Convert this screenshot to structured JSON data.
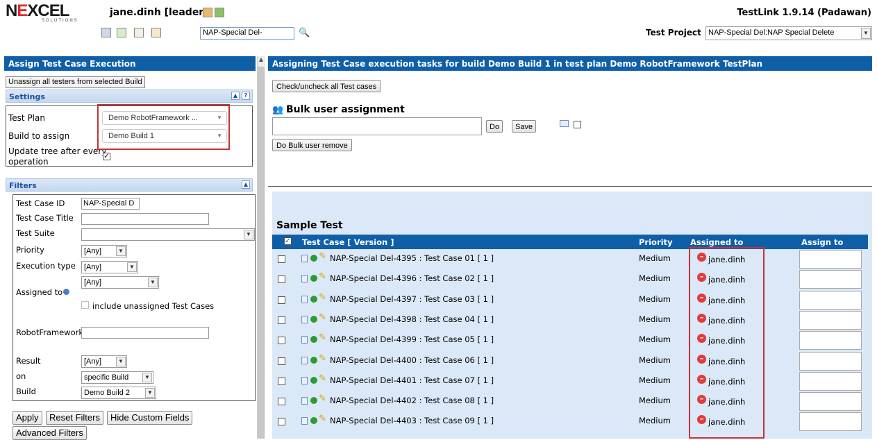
{
  "header": {
    "logo_brand_a": "N",
    "logo_brand_e": "E",
    "logo_brand_b": "XCEL",
    "logo_sub": "SOLUTIONS",
    "user": "jane.dinh [leader]",
    "app_version": "TestLink 1.9.14 (Padawan)",
    "tc_search_value": "NAP-Special Del-",
    "test_project_label": "Test Project",
    "test_project_value": "NAP-Special Del:NAP Special Delete"
  },
  "left": {
    "title": "Assign Test Case Execution",
    "unassign_btn": "Unassign all testers from selected Build",
    "settings": {
      "title": "Settings",
      "test_plan_label": "Test Plan",
      "test_plan_value": "Demo RobotFramework ...",
      "build_label": "Build to assign",
      "build_value": "Demo Build 1",
      "update_tree_label_a": "Update tree after every",
      "update_tree_label_b": "operation"
    },
    "filters": {
      "title": "Filters",
      "tc_id_label": "Test Case ID",
      "tc_id_value": "NAP-Special D",
      "tc_title_label": "Test Case Title",
      "suite_label": "Test Suite",
      "priority_label": "Priority",
      "priority_value": "[Any]",
      "exec_type_label": "Execution type",
      "exec_type_value": "[Any]",
      "assigned_label": "Assigned to",
      "assigned_value": "[Any]",
      "include_unassigned": "include unassigned Test Cases",
      "robot_label": "RobotFramework",
      "result_label": "Result",
      "result_value": "[Any]",
      "on_label": "on",
      "on_value": "specific Build",
      "build_label": "Build",
      "build_value": "Demo Build 2"
    },
    "buttons": {
      "apply": "Apply",
      "reset": "Reset Filters",
      "hide_custom": "Hide Custom Fields",
      "advanced": "Advanced Filters"
    }
  },
  "right": {
    "title": "Assigning Test Case execution tasks for build Demo Build 1 in test plan Demo RobotFramework TestPlan",
    "check_all_btn": "Check/uncheck all Test cases",
    "bulk_title": "Bulk user assignment",
    "do_btn": "Do",
    "save_btn": "Save",
    "bulk_remove_btn": "Do Bulk user remove",
    "suite_name": "Sample Test",
    "columns": {
      "test_case": "Test Case [ Version ]",
      "priority": "Priority",
      "assigned_to": "Assigned to",
      "assign_to": "Assign to"
    },
    "rows": [
      {
        "tc": "NAP-Special Del-4395 : Test Case 01  [ 1 ]",
        "priority": "Medium",
        "assigned": "jane.dinh"
      },
      {
        "tc": "NAP-Special Del-4396 : Test Case 02  [ 1 ]",
        "priority": "Medium",
        "assigned": "jane.dinh"
      },
      {
        "tc": "NAP-Special Del-4397 : Test Case 03  [ 1 ]",
        "priority": "Medium",
        "assigned": "jane.dinh"
      },
      {
        "tc": "NAP-Special Del-4398 : Test Case 04  [ 1 ]",
        "priority": "Medium",
        "assigned": "jane.dinh"
      },
      {
        "tc": "NAP-Special Del-4399 : Test Case 05  [ 1 ]",
        "priority": "Medium",
        "assigned": "jane.dinh"
      },
      {
        "tc": "NAP-Special Del-4400 : Test Case 06  [ 1 ]",
        "priority": "Medium",
        "assigned": "jane.dinh"
      },
      {
        "tc": "NAP-Special Del-4401 : Test Case 07  [ 1 ]",
        "priority": "Medium",
        "assigned": "jane.dinh"
      },
      {
        "tc": "NAP-Special Del-4402 : Test Case 08  [ 1 ]",
        "priority": "Medium",
        "assigned": "jane.dinh"
      },
      {
        "tc": "NAP-Special Del-4403 : Test Case 09  [ 1 ]",
        "priority": "Medium",
        "assigned": "jane.dinh"
      }
    ]
  },
  "colors": {
    "header_blue": "#0f5fa8",
    "highlight_red": "#c83232",
    "table_bg": "#dbe8f7"
  }
}
